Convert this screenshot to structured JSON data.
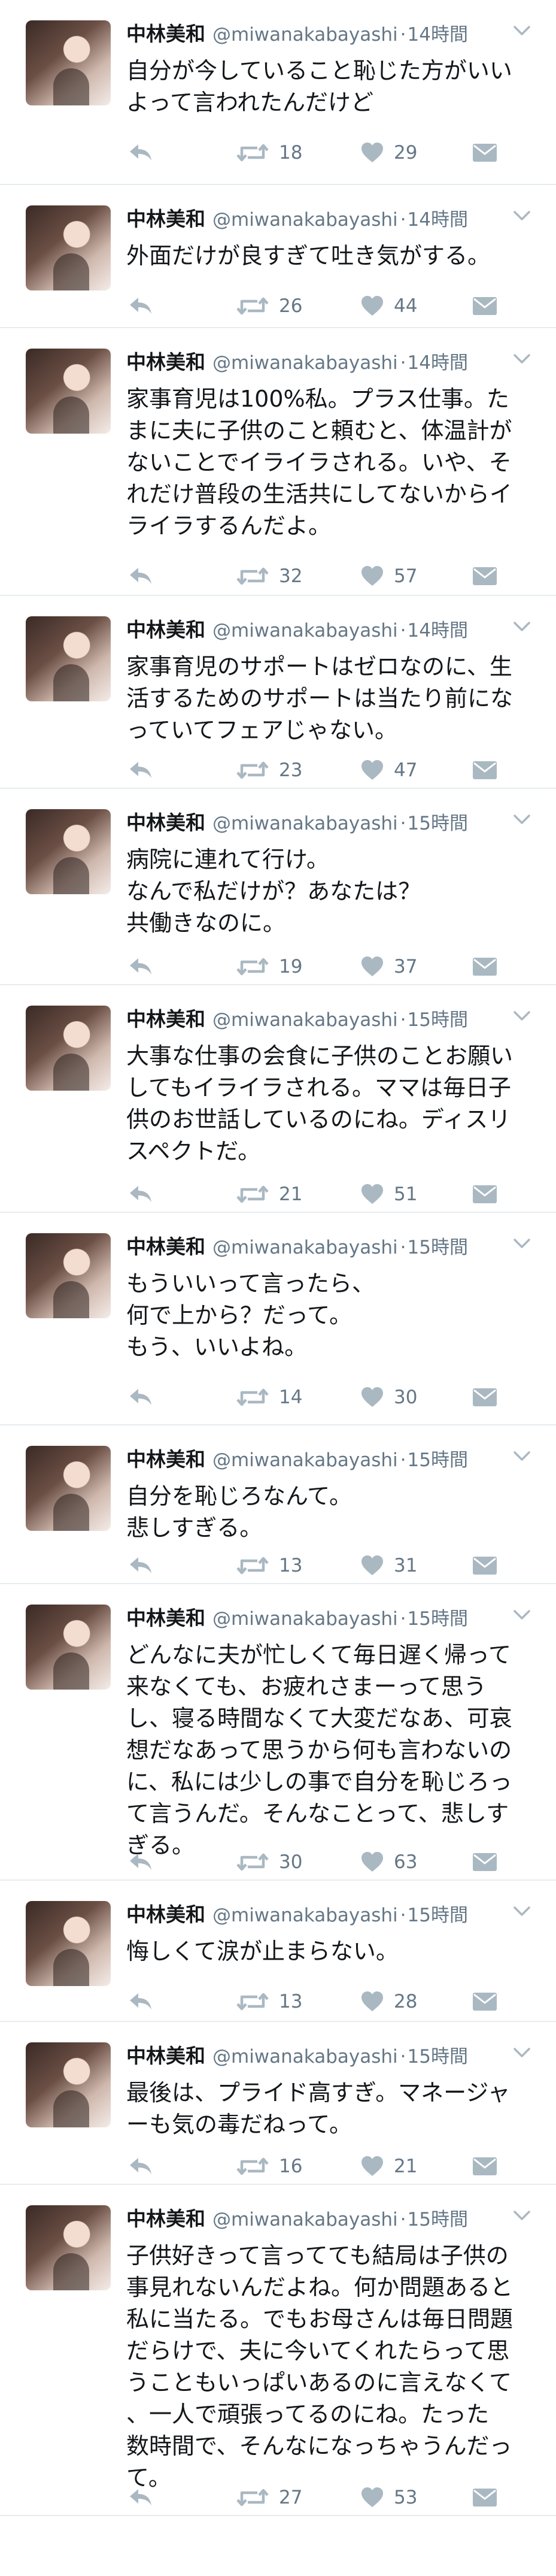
{
  "tweets": [
    {
      "name": "中林美和",
      "handle": "@miwanakabayashi",
      "dot": "·",
      "time": "14時間",
      "text": "自分が今していること恥じた方がいい\nよって言われたんだけど",
      "retweets": "18",
      "likes": "29"
    },
    {
      "name": "中林美和",
      "handle": "@miwanakabayashi",
      "dot": "·",
      "time": "14時間",
      "text": "外面だけが良すぎて吐き気がする。",
      "retweets": "26",
      "likes": "44"
    },
    {
      "name": "中林美和",
      "handle": "@miwanakabayashi",
      "dot": "·",
      "time": "14時間",
      "text": "家事育児は100%私。プラス仕事。た\nまに夫に子供のこと頼むと、体温計が\nないことでイライラされる。いや、そ\nれだけ普段の生活共にしてないからイ\nライラするんだよ。",
      "retweets": "32",
      "likes": "57"
    },
    {
      "name": "中林美和",
      "handle": "@miwanakabayashi",
      "dot": "·",
      "time": "14時間",
      "text": "家事育児のサポートはゼロなのに、生\n活するためのサポートは当たり前にな\nっていてフェアじゃない。",
      "retweets": "23",
      "likes": "47"
    },
    {
      "name": "中林美和",
      "handle": "@miwanakabayashi",
      "dot": "·",
      "time": "15時間",
      "text": "病院に連れて行け。\nなんで私だけが？あなたは？\n共働きなのに。",
      "retweets": "19",
      "likes": "37"
    },
    {
      "name": "中林美和",
      "handle": "@miwanakabayashi",
      "dot": "·",
      "time": "15時間",
      "text": "大事な仕事の会食に子供のことお願い\nしてもイライラされる。ママは毎日子\n供のお世話しているのにね。ディスリ\nスペクトだ。",
      "retweets": "21",
      "likes": "51"
    },
    {
      "name": "中林美和",
      "handle": "@miwanakabayashi",
      "dot": "·",
      "time": "15時間",
      "text": "もういいって言ったら、\n何で上から？だって。\nもう、いいよね。",
      "retweets": "14",
      "likes": "30"
    },
    {
      "name": "中林美和",
      "handle": "@miwanakabayashi",
      "dot": "·",
      "time": "15時間",
      "text": "自分を恥じろなんて。\n悲しすぎる。",
      "retweets": "13",
      "likes": "31"
    },
    {
      "name": "中林美和",
      "handle": "@miwanakabayashi",
      "dot": "·",
      "time": "15時間",
      "text": "どんなに夫が忙しくて毎日遅く帰って\n来なくても、お疲れさまーって思う\nし、寝る時間なくて大変だなあ、可哀\n想だなあって思うから何も言わないの\nに、私には少しの事で自分を恥じろっ\nて言うんだ。そんなことって、悲しす\nぎる。",
      "retweets": "30",
      "likes": "63"
    },
    {
      "name": "中林美和",
      "handle": "@miwanakabayashi",
      "dot": "·",
      "time": "15時間",
      "text": "悔しくて涙が止まらない。",
      "retweets": "13",
      "likes": "28"
    },
    {
      "name": "中林美和",
      "handle": "@miwanakabayashi",
      "dot": "·",
      "time": "15時間",
      "text": "最後は、プライド高すぎ。マネージャ\nーも気の毒だねって。",
      "retweets": "16",
      "likes": "21"
    },
    {
      "name": "中林美和",
      "handle": "@miwanakabayashi",
      "dot": "·",
      "time": "15時間",
      "text": "子供好きって言ってても結局は子供の\n事見れないんだよね。何か問題あると\n私に当たる。でもお母さんは毎日問題\nだらけで、夫に今いてくれたらって思\nうこともいっぱいあるのに言えなくて\n、一人で頑張ってるのにね。たった\n数時間で、そんなになっちゃうんだっ\nて。",
      "retweets": "27",
      "likes": "53"
    }
  ],
  "icons": {
    "reply": "reply-icon",
    "retweet": "retweet-icon",
    "like": "heart-icon",
    "dm": "direct-message-icon",
    "caret": "chevron-down-icon"
  },
  "colors": {
    "icon": "#aab8c2",
    "meta": "#657786",
    "text": "#14171a",
    "divider": "#e6ecf0"
  }
}
